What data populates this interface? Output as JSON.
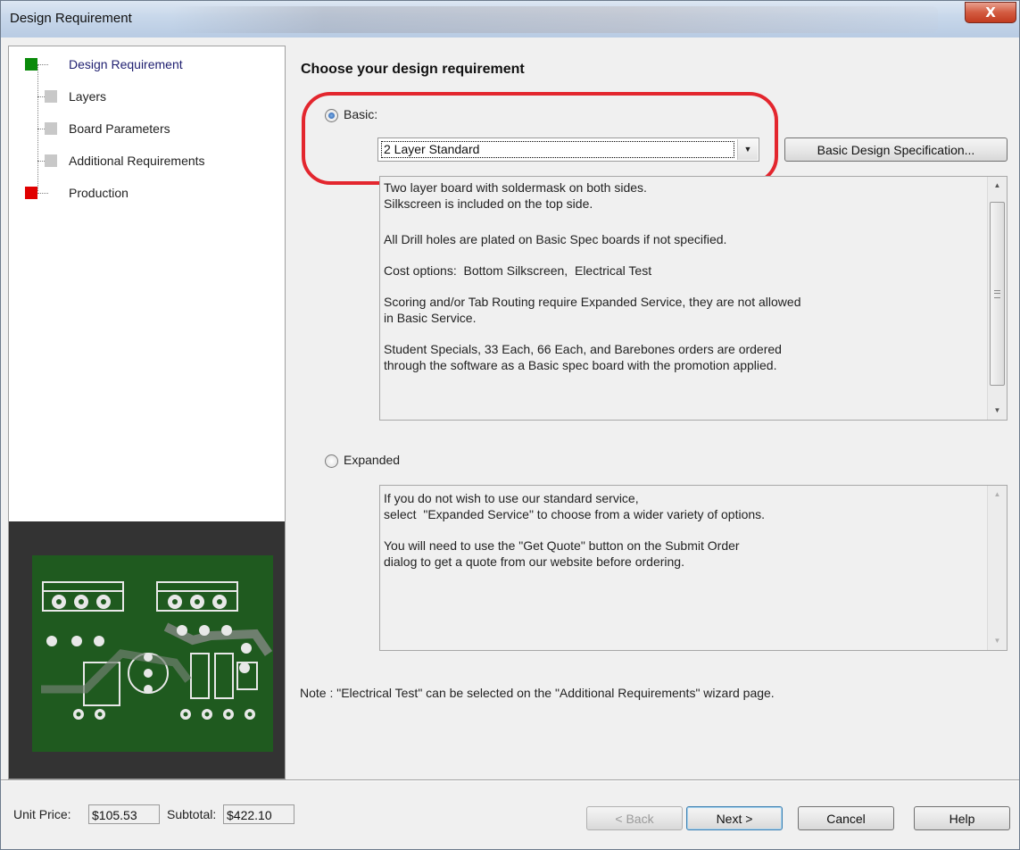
{
  "window": {
    "title": "Design Requirement",
    "close_glyph": "X"
  },
  "tree": {
    "items": [
      {
        "label": "Design Requirement",
        "color": "#0a8a0a"
      },
      {
        "label": "Layers",
        "color": "#c8c8c8"
      },
      {
        "label": "Board Parameters",
        "color": "#c8c8c8"
      },
      {
        "label": "Additional Requirements",
        "color": "#c8c8c8"
      },
      {
        "label": "Production",
        "color": "#e00000"
      }
    ]
  },
  "main": {
    "heading": "Choose your design requirement",
    "basic": {
      "label": "Basic:",
      "selected": true,
      "combo_value": "2 Layer Standard",
      "spec_button": "Basic Design Specification...",
      "description": [
        "Two layer board with soldermask on both sides.",
        "Silkscreen is included on the top side.",
        "",
        "All Drill holes are plated on Basic Spec boards if not specified.",
        "",
        "Cost options:  Bottom Silkscreen,  Electrical Test",
        "",
        "Scoring and/or Tab Routing require Expanded Service, they are not allowed",
        "in Basic Service.",
        "",
        "Student Specials, 33 Each, 66 Each, and Barebones orders are ordered",
        "through the software as a Basic spec board with the promotion applied."
      ]
    },
    "expanded": {
      "label": "Expanded",
      "selected": false,
      "description": [
        "If you do not wish to use our standard service,",
        "select  \"Expanded Service\" to choose from a wider variety of options.",
        "",
        "You will need to use the \"Get Quote\" button on the Submit Order",
        "dialog to get a quote from our website before ordering."
      ]
    },
    "note": "Note : \"Electrical Test\" can be selected on the \"Additional Requirements\" wizard page."
  },
  "footer": {
    "unit_price_label": "Unit Price:",
    "unit_price": "$105.53",
    "subtotal_label": "Subtotal:",
    "subtotal": "$422.10",
    "back": "< Back",
    "next": "Next >",
    "cancel": "Cancel",
    "help": "Help"
  },
  "icons": {
    "up_arrow": "▲",
    "down_arrow": "▼",
    "combo_arrow": "▼"
  }
}
